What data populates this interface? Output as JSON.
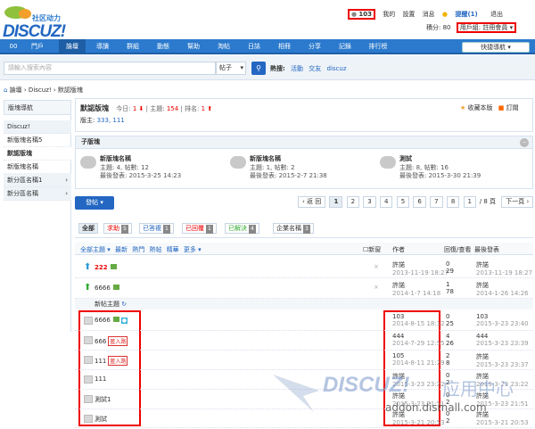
{
  "header": {
    "logo_cn": "社区动力",
    "logo_en": "DISCUZ!",
    "user_credits": "103",
    "links": [
      "我的",
      "設置",
      "消息"
    ],
    "reminder": "提醒(1)",
    "logout": "退出",
    "credit_text": "積分: 80",
    "usergroup": "用戶組: 註冊會員"
  },
  "nav": {
    "items": [
      "00",
      "門戶",
      "論壇",
      "導讀",
      "群組",
      "動態",
      "幫助",
      "淘帖",
      "日誌",
      "相冊",
      "分享",
      "記錄",
      "排行榜"
    ],
    "quick": "快捷導航"
  },
  "search": {
    "placeholder": "請輸入搜索內容",
    "scope": "帖子",
    "hot_label": "熱搜:",
    "hot": [
      "活動",
      "交友",
      "discuz"
    ]
  },
  "breadcrumb": "論壇 › Discuz! › 默認版塊",
  "sidebar": {
    "head": "版塊導航",
    "items": [
      "Discuz!",
      "新版塊名稱5",
      "默認版塊",
      "新版塊名稱",
      "新分區名稱1",
      "新分區名稱"
    ]
  },
  "forum": {
    "name": "默認版塊",
    "today_label": "今日:",
    "today": "1",
    "topic_label": "主題:",
    "topics": "154",
    "rank_label": "排名:",
    "rank": "1",
    "moderator_label": "版主:",
    "moderators": "333, 111",
    "fav": "收藏本版",
    "rss": "訂閱"
  },
  "subforums": {
    "head": "子版塊",
    "list": [
      {
        "name": "新版塊名稱",
        "stats": "主題: 4, 帖數: 12",
        "last": "最後發表: 2015-3-25 14:23"
      },
      {
        "name": "新版塊名稱",
        "stats": "主題: 1, 帖數: 2",
        "last": "最後發表: 2015-2-7 21:38"
      },
      {
        "name": "測試",
        "stats": "主題: 8, 帖數: 16",
        "last": "最後發表: 2015-3-30 21:39"
      }
    ]
  },
  "post_button": "發帖",
  "pager": {
    "prev": "‹ 返 回",
    "pages": [
      "1",
      "2",
      "3",
      "4",
      "5",
      "6",
      "7",
      "8"
    ],
    "current": "1",
    "input": "1",
    "total": "/ 8 頁",
    "next": "下一頁 ›"
  },
  "types": [
    {
      "label": "全部",
      "count": ""
    },
    {
      "label": "求助",
      "count": "5"
    },
    {
      "label": "已答複",
      "count": "1"
    },
    {
      "label": "已回覆",
      "count": "1"
    },
    {
      "label": "已解決",
      "count": "4"
    },
    {
      "label": "企業名稱",
      "count": "3"
    }
  ],
  "filters": {
    "all": "全部主題",
    "list": [
      "最新",
      "熱門",
      "熱帖",
      "精華",
      "更多"
    ],
    "newwin": "新窗",
    "author": "作者",
    "replies": "回復/查看",
    "last": "最後發表"
  },
  "newtopics": "新帖主題",
  "threads": [
    {
      "title": "222",
      "author": "許諾",
      "adate": "2013-11-19 18:27",
      "rep": "0",
      "view": "29",
      "last": "許諾",
      "ldate": "2013-11-19 18:27"
    },
    {
      "title": "6666",
      "author": "許諾",
      "adate": "2014-1-7 14:18",
      "rep": "1",
      "view": "78",
      "last": "許諾",
      "ldate": "2014-1-26 14:26"
    },
    {
      "title": "6666",
      "tag": "",
      "author": "103",
      "adate": "2014-8-15 18:12",
      "rep": "0",
      "view": "25",
      "last": "103",
      "ldate": "2015-3-23 23:40"
    },
    {
      "title": "666",
      "tag": "匿入路",
      "author": "444",
      "adate": "2014-7-29 12:55",
      "rep": "4",
      "view": "26",
      "last": "444",
      "ldate": "2015-3-23 23:39"
    },
    {
      "title": "111",
      "tag": "匿入路",
      "author": "105",
      "adate": "2014-8-11 21:29",
      "rep": "2",
      "view": "8",
      "last": "許諾",
      "ldate": "2015-3-23 23:37"
    },
    {
      "title": "111",
      "author": "許諾",
      "adate": "2015-3-23 23:22",
      "rep": "0",
      "view": "2",
      "last": "許諾",
      "ldate": "2015-3-23 23:22"
    },
    {
      "title": "測試1",
      "author": "許諾",
      "adate": "2015-3-23 21:51",
      "rep": "0",
      "view": "2",
      "last": "許諾",
      "ldate": "2015-3-23 21:51"
    },
    {
      "title": "測試",
      "author": "許諾",
      "adate": "2015-3-21 20:53",
      "rep": "0",
      "view": "2",
      "last": "許諾",
      "ldate": "2015-3-21 20:53"
    }
  ],
  "watermark": {
    "brand": "DISCUZ!",
    "cn": "应用中心",
    "url": "addon.dismall.com"
  },
  "colors": {
    "nav": "#2b7acd",
    "accent": "#2367c2",
    "highlight": "#e00000"
  }
}
